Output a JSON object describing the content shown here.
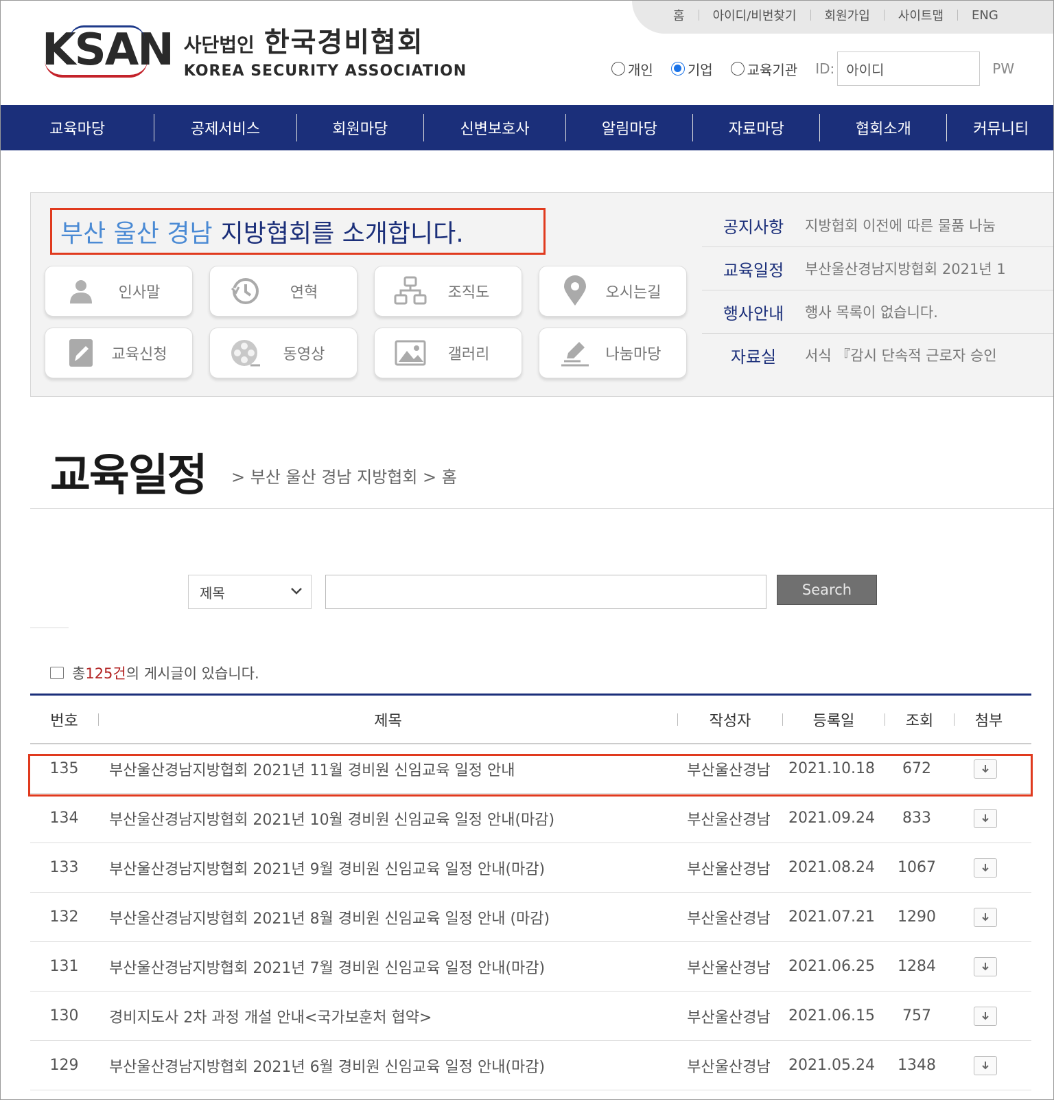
{
  "header": {
    "util_links": [
      "홈",
      "아이디/비번찾기",
      "회원가입",
      "사이트맵",
      "ENG"
    ],
    "logo": {
      "mark": "KSAN",
      "org_type": "사단법인",
      "org_name": "한국경비협회",
      "org_name_en": "KOREA SECURITY ASSOCIATION"
    },
    "login": {
      "member_types": [
        {
          "label": "개인",
          "checked": false
        },
        {
          "label": "기업",
          "checked": true
        },
        {
          "label": "교육기관",
          "checked": false
        }
      ],
      "id_label": "ID:",
      "id_placeholder": "아이디",
      "pw_label": "PW"
    }
  },
  "nav": [
    "교육마당",
    "공제서비스",
    "회원마당",
    "신변보호사",
    "알림마당",
    "자료마당",
    "협회소개",
    "커뮤니티"
  ],
  "intro": {
    "title_highlight": "부산 울산 경남",
    "title_rest": "지방협회를 소개합니다.",
    "quick_buttons": [
      {
        "label": "인사말",
        "icon": "person-icon"
      },
      {
        "label": "연혁",
        "icon": "history-icon"
      },
      {
        "label": "조직도",
        "icon": "org-chart-icon"
      },
      {
        "label": "오시는길",
        "icon": "map-pin-icon"
      },
      {
        "label": "교육신청",
        "icon": "edit-form-icon"
      },
      {
        "label": "동영상",
        "icon": "film-reel-icon"
      },
      {
        "label": "갤러리",
        "icon": "image-icon"
      },
      {
        "label": "나눔마당",
        "icon": "pen-icon"
      }
    ],
    "news": [
      {
        "category": "공지사항",
        "text": "지방협회 이전에 따른 물품 나눔"
      },
      {
        "category": "교육일정",
        "text": "부산울산경남지방협회 2021년 1"
      },
      {
        "category": "행사안내",
        "text": "행사 목록이 없습니다."
      },
      {
        "category": "자료실",
        "text": "서식 『감시 단속적 근로자 승인"
      }
    ]
  },
  "page": {
    "title": "교육일정",
    "breadcrumb": "> 부산 울산 경남 지방협회 > 홈"
  },
  "search": {
    "field_selected": "제목",
    "query": "",
    "button_label": "Search"
  },
  "board": {
    "count_prefix": "총 ",
    "count": "125건",
    "count_suffix": "의 게시글이 있습니다.",
    "columns": {
      "no": "번호",
      "title": "제목",
      "author": "작성자",
      "date": "등록일",
      "views": "조회",
      "attach": "첨부"
    },
    "rows": [
      {
        "no": "135",
        "title": "부산울산경남지방협회 2021년 11월 경비원 신임교육 일정 안내",
        "author": "부산울산경남",
        "date": "2021.10.18",
        "views": "672"
      },
      {
        "no": "134",
        "title": "부산울산경남지방협회 2021년 10월 경비원 신임교육 일정 안내(마감)",
        "author": "부산울산경남",
        "date": "2021.09.24",
        "views": "833"
      },
      {
        "no": "133",
        "title": "부산울산경남지방협회 2021년 9월 경비원 신임교육 일정 안내(마감)",
        "author": "부산울산경남",
        "date": "2021.08.24",
        "views": "1067"
      },
      {
        "no": "132",
        "title": "부산울산경남지방협회 2021년 8월 경비원 신임교육 일정 안내 (마감)",
        "author": "부산울산경남",
        "date": "2021.07.21",
        "views": "1290"
      },
      {
        "no": "131",
        "title": "부산울산경남지방협회 2021년 7월 경비원 신임교육 일정 안내(마감)",
        "author": "부산울산경남",
        "date": "2021.06.25",
        "views": "1284"
      },
      {
        "no": "130",
        "title": "경비지도사 2차 과정 개설 안내<국가보훈처 협약>",
        "author": "부산울산경남",
        "date": "2021.06.15",
        "views": "757"
      },
      {
        "no": "129",
        "title": "부산울산경남지방협회 2021년 6월 경비원 신임교육 일정 안내(마감)",
        "author": "부산울산경남",
        "date": "2021.05.24",
        "views": "1348"
      }
    ]
  },
  "colors": {
    "nav_bg": "#1b2f7a",
    "highlight_border": "#e03a1e",
    "accent_blue": "#4a8ad4",
    "count_red": "#b22222"
  }
}
